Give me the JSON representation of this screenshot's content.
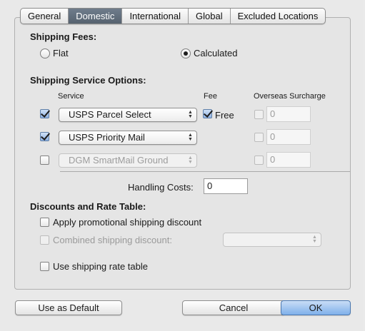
{
  "tabs": [
    {
      "label": "General",
      "active": false
    },
    {
      "label": "Domestic",
      "active": true
    },
    {
      "label": "International",
      "active": false
    },
    {
      "label": "Global",
      "active": false
    },
    {
      "label": "Excluded Locations",
      "active": false
    }
  ],
  "shipping_fees": {
    "heading": "Shipping Fees:",
    "flat_label": "Flat",
    "calculated_label": "Calculated",
    "selected": "Calculated"
  },
  "service_options": {
    "heading": "Shipping Service Options:",
    "col_service": "Service",
    "col_fee": "Fee",
    "col_surcharge": "Overseas Surcharge",
    "rows": [
      {
        "enabled": true,
        "service": "USPS Parcel Select",
        "free_shown": true,
        "free_checked": true,
        "free_label": "Free",
        "surcharge_checked": false,
        "surcharge_value": "0"
      },
      {
        "enabled": true,
        "service": "USPS Priority Mail",
        "free_shown": false,
        "surcharge_checked": false,
        "surcharge_value": "0"
      },
      {
        "enabled": false,
        "service": "DGM SmartMail Ground",
        "free_shown": false,
        "surcharge_checked": false,
        "surcharge_value": "0"
      }
    ]
  },
  "handling": {
    "label": "Handling Costs:",
    "value": "0"
  },
  "discounts": {
    "heading": "Discounts and Rate Table:",
    "promo_label": "Apply promotional shipping discount",
    "promo_checked": false,
    "combined_label": "Combined shipping discount:",
    "combined_enabled": false,
    "rate_table_label": "Use shipping rate table",
    "rate_table_checked": false
  },
  "buttons": {
    "use_default": "Use as Default",
    "cancel": "Cancel",
    "ok": "OK"
  },
  "colors": {
    "accent": "#7fb0ea",
    "tab_active": "#5f6b78"
  }
}
